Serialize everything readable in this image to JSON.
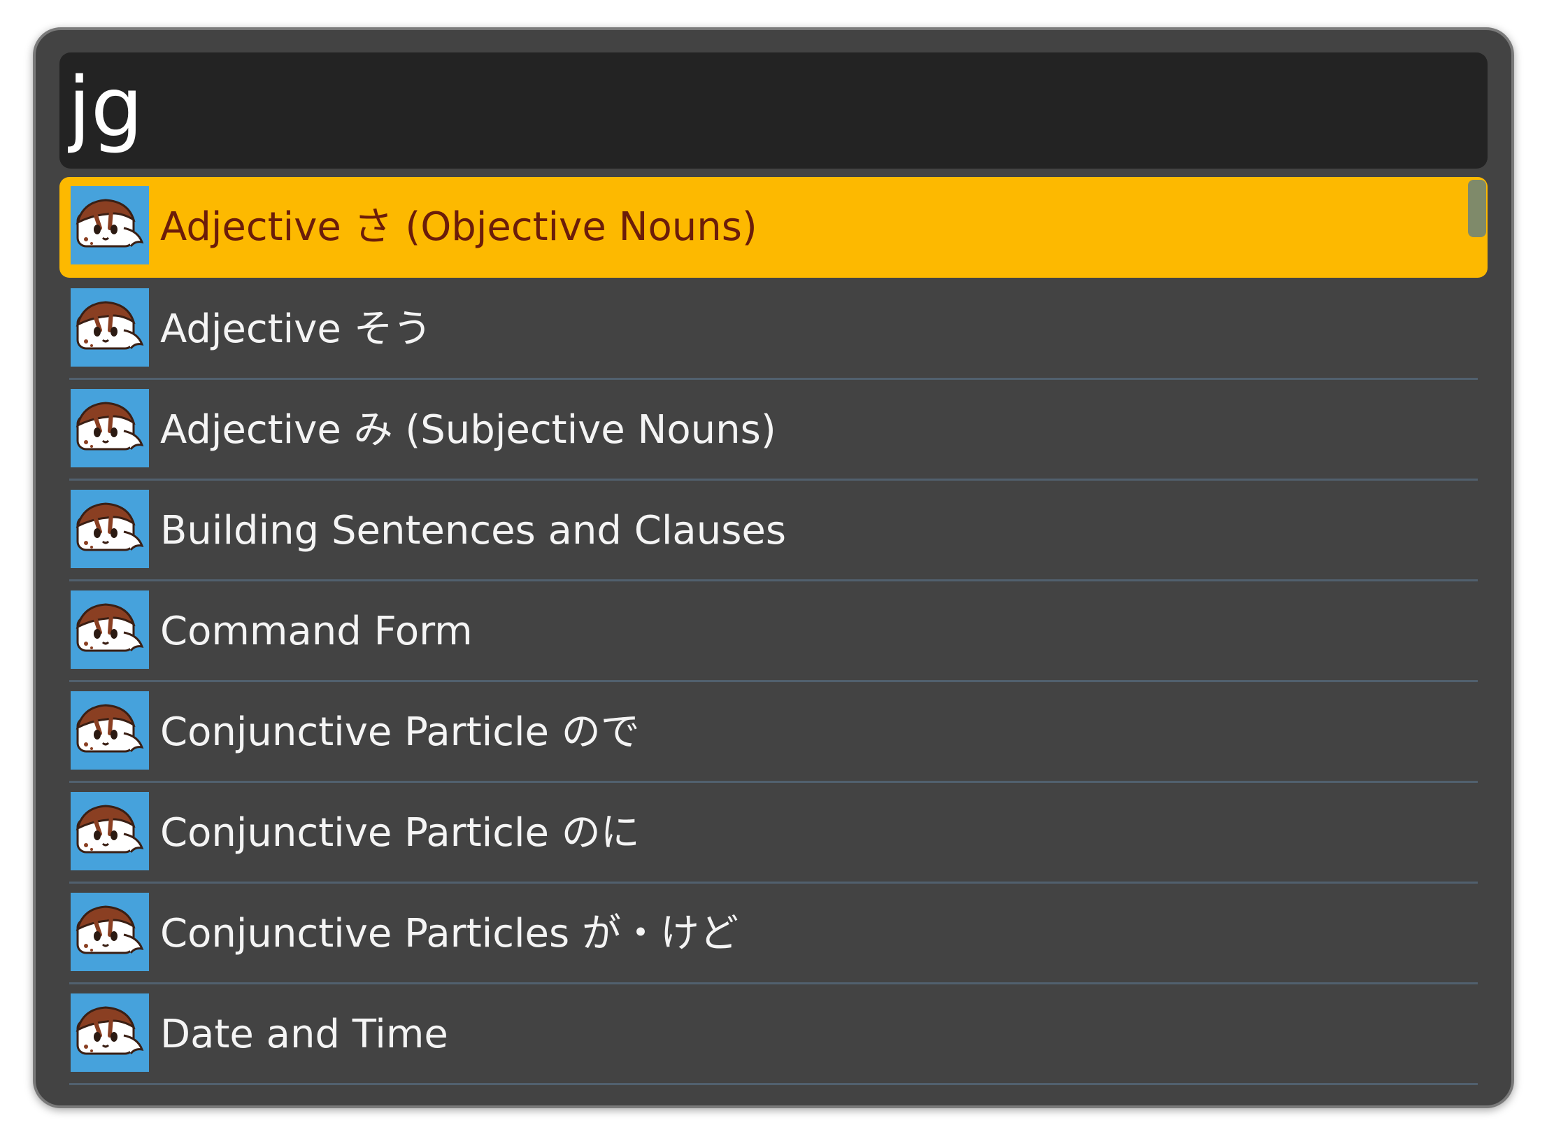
{
  "search": {
    "value": "jg",
    "placeholder": ""
  },
  "results": [
    {
      "label": "Adjective さ (Objective Nouns)",
      "icon": "jisho-mascot-icon",
      "selected": true
    },
    {
      "label": "Adjective そう",
      "icon": "jisho-mascot-icon",
      "selected": false
    },
    {
      "label": "Adjective み (Subjective Nouns)",
      "icon": "jisho-mascot-icon",
      "selected": false
    },
    {
      "label": "Building Sentences and Clauses",
      "icon": "jisho-mascot-icon",
      "selected": false
    },
    {
      "label": "Command Form",
      "icon": "jisho-mascot-icon",
      "selected": false
    },
    {
      "label": "Conjunctive Particle ので",
      "icon": "jisho-mascot-icon",
      "selected": false
    },
    {
      "label": "Conjunctive Particle のに",
      "icon": "jisho-mascot-icon",
      "selected": false
    },
    {
      "label": "Conjunctive Particles が・けど",
      "icon": "jisho-mascot-icon",
      "selected": false
    },
    {
      "label": "Date and Time",
      "icon": "jisho-mascot-icon",
      "selected": false
    }
  ],
  "colors": {
    "selection": "#fdb900",
    "selected_text": "#6b1d0a",
    "icon_background": "#46a2dc",
    "panel": "#434343",
    "search_field": "#232323"
  }
}
